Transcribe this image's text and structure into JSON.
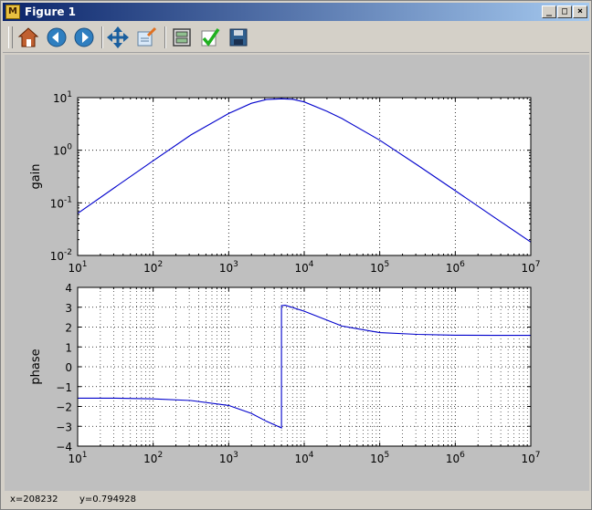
{
  "window": {
    "title": "Figure 1",
    "app_icon_glyph": "M"
  },
  "window_buttons": [
    "_",
    "□",
    "×"
  ],
  "toolbar": {
    "buttons": [
      {
        "name": "home-icon",
        "tooltip": "Home"
      },
      {
        "name": "back-icon",
        "tooltip": "Back"
      },
      {
        "name": "forward-icon",
        "tooltip": "Forward"
      },
      {
        "name": "pan-icon",
        "tooltip": "Pan"
      },
      {
        "name": "zoom-icon",
        "tooltip": "Zoom"
      },
      {
        "name": "subplots-icon",
        "tooltip": "Configure subplots"
      },
      {
        "name": "edit-icon",
        "tooltip": "Edit"
      },
      {
        "name": "save-icon",
        "tooltip": "Save"
      }
    ]
  },
  "status": {
    "x": "x=208232",
    "y": "y=0.794928"
  },
  "colors": {
    "line": "#0000cc",
    "canvas": "#bfbfbf",
    "axes_bg": "#ffffff"
  },
  "chart_data": [
    {
      "type": "line",
      "xscale": "log",
      "yscale": "log",
      "xlim": [
        10,
        10000000
      ],
      "ylim": [
        0.01,
        10
      ],
      "xticks": [
        "10^1",
        "10^2",
        "10^3",
        "10^4",
        "10^5",
        "10^6",
        "10^7"
      ],
      "yticks": [
        "10^-2",
        "10^-1",
        "10^0",
        "10^1"
      ],
      "grid": true,
      "xlabel": "",
      "ylabel": "gain",
      "series": [
        {
          "x": [
            10,
            31.6,
            100,
            316,
            1000,
            2000,
            3162,
            5000,
            7000,
            10000,
            20000,
            31623,
            100000,
            316228,
            1000000,
            3162278,
            10000000
          ],
          "y": [
            0.063,
            0.2,
            0.63,
            1.95,
            5.0,
            7.8,
            9.2,
            9.5,
            9.3,
            8.3,
            5.5,
            4.0,
            1.55,
            0.52,
            0.17,
            0.055,
            0.018
          ]
        }
      ]
    },
    {
      "type": "line",
      "xscale": "log",
      "yscale": "linear",
      "xlim": [
        10,
        10000000
      ],
      "ylim": [
        -4,
        4
      ],
      "xticks": [
        "10^1",
        "10^2",
        "10^3",
        "10^4",
        "10^5",
        "10^6",
        "10^7"
      ],
      "yticks": [
        "−4",
        "−3",
        "−2",
        "−1",
        "0",
        "1",
        "2",
        "3",
        "4"
      ],
      "grid": true,
      "xlabel": "",
      "ylabel": "phase",
      "series": [
        {
          "x": [
            10,
            31.6,
            100,
            316,
            1000,
            2000,
            3162,
            5000,
            5001,
            5623,
            10000,
            20000,
            31623,
            100000,
            316228,
            1000000,
            3162278,
            10000000
          ],
          "y": [
            -1.58,
            -1.58,
            -1.62,
            -1.7,
            -1.95,
            -2.35,
            -2.75,
            -3.08,
            3.08,
            3.1,
            2.8,
            2.35,
            2.05,
            1.72,
            1.63,
            1.59,
            1.58,
            1.58
          ]
        }
      ]
    }
  ]
}
